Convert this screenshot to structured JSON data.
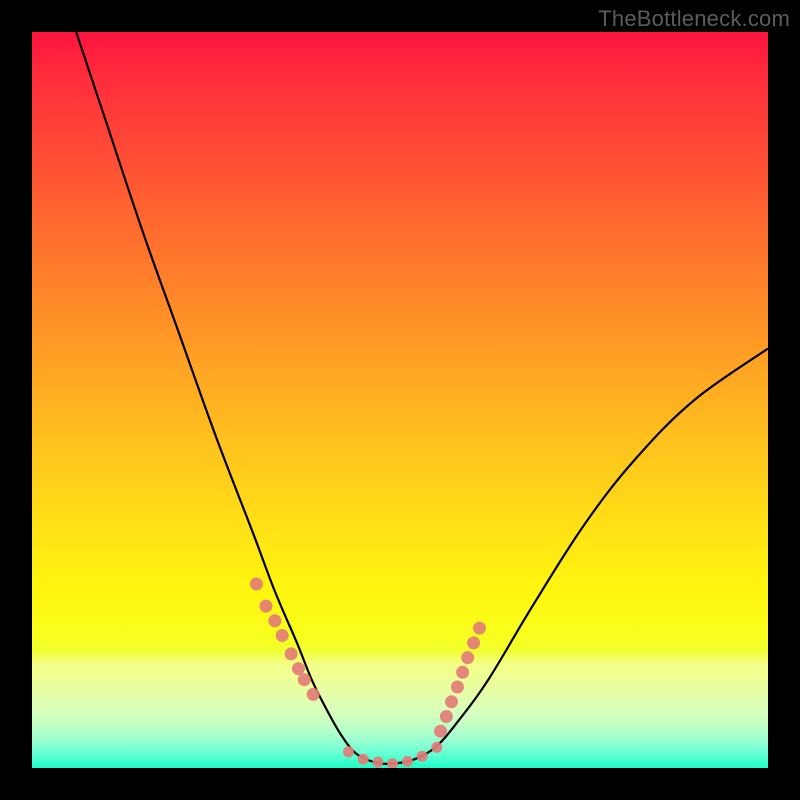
{
  "watermark": "TheBottleneck.com",
  "chart_data": {
    "type": "line",
    "title": "",
    "xlabel": "",
    "ylabel": "",
    "xlim": [
      0,
      100
    ],
    "ylim": [
      0,
      100
    ],
    "series": [
      {
        "name": "bottleneck-curve",
        "x": [
          6,
          10,
          15,
          20,
          25,
          30,
          33,
          36,
          38,
          40,
          42,
          44,
          46.5,
          49,
          52,
          55,
          58,
          62,
          68,
          75,
          82,
          90,
          100
        ],
        "y": [
          100,
          88,
          73,
          59,
          45,
          32,
          24,
          17,
          12,
          8,
          4.5,
          2,
          0.8,
          0.6,
          1.2,
          3,
          6.5,
          12,
          22,
          33,
          42,
          50,
          57
        ]
      }
    ],
    "markers": [
      {
        "name": "left-cluster",
        "x": [
          30.5,
          31.8,
          33.0,
          34.0,
          35.2,
          36.2,
          37.0,
          38.2
        ],
        "y": [
          25,
          22,
          20,
          18,
          15.5,
          13.5,
          12,
          10
        ]
      },
      {
        "name": "trough-cluster",
        "x": [
          43,
          45,
          47,
          49,
          51,
          53,
          55
        ],
        "y": [
          2.2,
          1.2,
          0.8,
          0.6,
          0.9,
          1.6,
          2.8
        ]
      },
      {
        "name": "right-cluster",
        "x": [
          55.5,
          56.3,
          57,
          57.8,
          58.5,
          59.2,
          60,
          60.8
        ],
        "y": [
          5,
          7,
          9,
          11,
          13,
          15,
          17,
          19
        ]
      }
    ],
    "marker_color": "#e37d78",
    "curve_color": "#000000",
    "gradient_stops": [
      {
        "pos": 0,
        "color": "#ff153e"
      },
      {
        "pos": 50,
        "color": "#ffc81c"
      },
      {
        "pos": 80,
        "color": "#f6ff2a"
      },
      {
        "pos": 100,
        "color": "#1affc6"
      }
    ]
  }
}
